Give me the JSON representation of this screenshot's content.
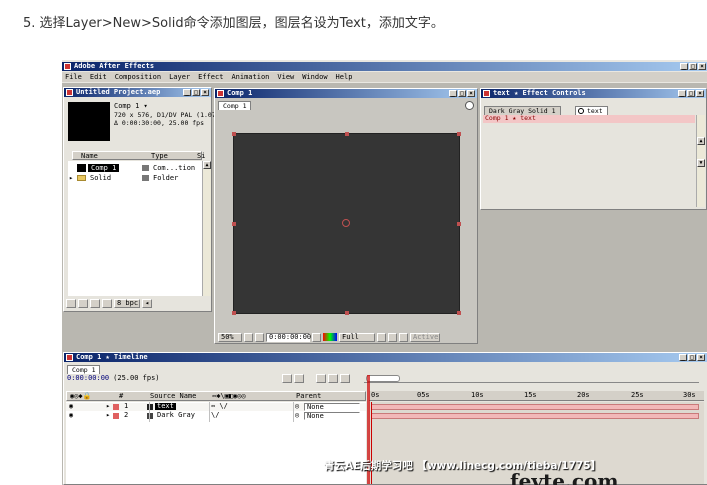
{
  "caption": "5. 选择Layer>New>Solid命令添加图层，图层名设为Text，添加文字。",
  "app": {
    "title": "Adobe After Effects",
    "window_buttons": [
      "_",
      "&#9633;",
      "×"
    ],
    "menu": [
      "File",
      "Edit",
      "Composition",
      "Layer",
      "Effect",
      "Animation",
      "View",
      "Window",
      "Help"
    ]
  },
  "project": {
    "title": "Untitled Project.aep",
    "comp_name": "Comp 1 ▾",
    "comp_info_1": "720 x 576, D1/DV PAL (1.07)",
    "comp_info_2": "Δ 0:00:30:00, 25.00 fps",
    "col_name": "Name",
    "col_type": "Type",
    "col_size": "Si",
    "items": [
      {
        "name": "Comp 1",
        "type": "Com...tion"
      },
      {
        "name": "Solid",
        "type": "Folder"
      }
    ],
    "bpc": "8 bpc"
  },
  "comp_window": {
    "title": "Comp 1",
    "tab": "Comp 1",
    "zoom": "50%",
    "timecode": "0:00:00:00",
    "resolution": "Full",
    "active": "Active"
  },
  "effect_controls": {
    "title": "text ★ Effect Controls",
    "tab1": "Dark Gray Solid 1",
    "tab2": "text",
    "layer": "Comp 1 ★ text"
  },
  "timeline": {
    "title": "Comp 1 ★ Timeline",
    "tab": "Comp 1",
    "time": "0:00:00:00",
    "fps": "(25.00 fps)",
    "col_num": "#",
    "col_source": "Source Name",
    "col_parent": "Parent",
    "ruler": [
      "0s",
      "05s",
      "10s",
      "15s",
      "20s",
      "25s",
      "30s"
    ],
    "layers": [
      {
        "num": "1",
        "name": "text",
        "parent": "None"
      },
      {
        "num": "2",
        "name": "Dark Gray",
        "parent": "None"
      }
    ]
  },
  "watermark": "青云AE后期学习吧  【www.linecg.com/tieba/1775】",
  "watermark2": "fevte.com",
  "colors": {
    "titlebar": "#0a246a",
    "canvas": "#353535",
    "layer_bar": "#f2b8b8"
  }
}
